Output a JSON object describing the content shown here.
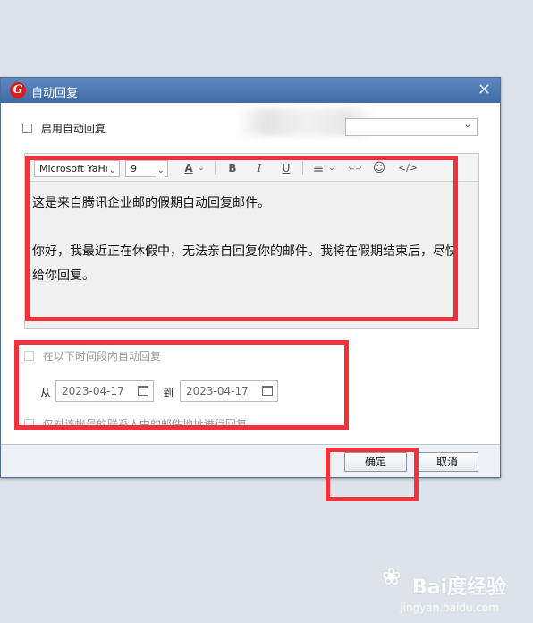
{
  "window": {
    "title": "自动回复",
    "logo": "G",
    "close": "✕"
  },
  "enable": {
    "label": "启用自动回复",
    "checked": false
  },
  "account": {
    "selected": ""
  },
  "toolbar": {
    "font": "Microsoft YaHei",
    "size": "9",
    "font_color_glyph": "A",
    "bold": "B",
    "italic": "I",
    "underline": "U",
    "align_glyph": "≡",
    "link_glyph": "⊂⊃",
    "emoji_glyph": "☺",
    "code_glyph": "</>",
    "dropdown_glyph": "⌄"
  },
  "message": {
    "line1": "这是来自腾讯企业邮的假期自动回复邮件。",
    "line2": "你好，我最近正在休假中，无法亲自回复你的邮件。我将在假期结束后，尽快给你回复。"
  },
  "schedule": {
    "label": "在以下时间段内自动回复",
    "from_label": "从",
    "from_date": "2023-04-17",
    "to_label": "到",
    "to_date": "2023-04-17"
  },
  "contacts_only": {
    "label": "仅对该帐号的联系人中的邮件地址进行回复"
  },
  "footer": {
    "ok_label": "确定",
    "cancel_label": "取消"
  },
  "watermark": {
    "brand": "Bai度经验",
    "sub": "jingyan.baidu.com"
  },
  "colors": {
    "titlebar": "#4a77b4",
    "highlight": "#f2323a",
    "logo": "#d62020"
  }
}
